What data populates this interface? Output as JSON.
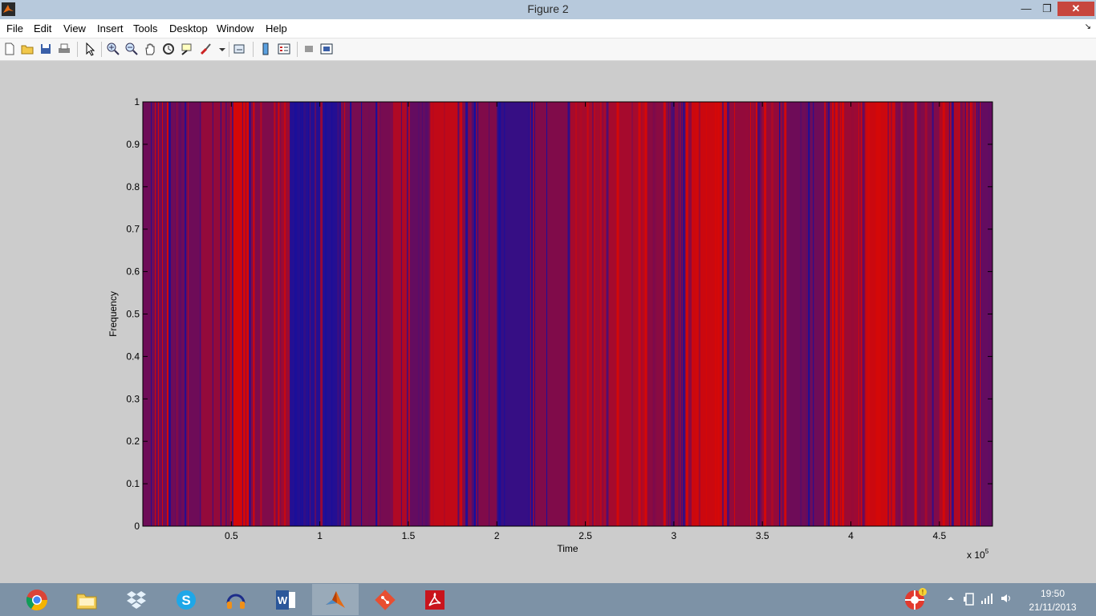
{
  "window": {
    "title": "Figure 2"
  },
  "menu": [
    "File",
    "Edit",
    "View",
    "Insert",
    "Tools",
    "Desktop",
    "Window",
    "Help"
  ],
  "toolbar": [
    "new-figure-icon",
    "open-file-icon",
    "save-icon",
    "print-icon",
    "edit-plot-arrow-icon",
    "zoom-in-icon",
    "zoom-out-icon",
    "pan-hand-icon",
    "rotate-3d-icon",
    "data-cursor-icon",
    "brush-icon",
    "link-plot-icon",
    "insert-colorbar-icon",
    "insert-legend-icon",
    "hide-plot-tools-icon",
    "show-plot-tools-icon"
  ],
  "chart_data": {
    "type": "heatmap",
    "title": "",
    "xlabel": "Time",
    "ylabel": "Frequency",
    "x_exponent_label": "x 10",
    "x_exponent": "5",
    "xlim": [
      0,
      4.8
    ],
    "ylim": [
      0,
      1
    ],
    "x_ticks": [
      "0.5",
      "1",
      "1.5",
      "2",
      "2.5",
      "3",
      "3.5",
      "4",
      "4.5"
    ],
    "y_ticks": [
      "0",
      "0.1",
      "0.2",
      "0.3",
      "0.4",
      "0.5",
      "0.6",
      "0.7",
      "0.8",
      "0.9",
      "1"
    ],
    "colors": {
      "low": "#1a0f9a",
      "high": "#d40808",
      "mid": "#8a0a3a"
    },
    "bands": [
      {
        "start": 0.0,
        "end": 0.33,
        "value": 0.45
      },
      {
        "start": 0.33,
        "end": 0.48,
        "value": 0.65
      },
      {
        "start": 0.48,
        "end": 0.6,
        "value": 1.0
      },
      {
        "start": 0.6,
        "end": 0.78,
        "value": 0.55
      },
      {
        "start": 0.78,
        "end": 0.83,
        "value": 0.7
      },
      {
        "start": 0.83,
        "end": 1.12,
        "value": 0.05
      },
      {
        "start": 1.12,
        "end": 1.4,
        "value": 0.5
      },
      {
        "start": 1.4,
        "end": 1.5,
        "value": 0.8
      },
      {
        "start": 1.5,
        "end": 1.62,
        "value": 0.4
      },
      {
        "start": 1.62,
        "end": 1.8,
        "value": 0.9
      },
      {
        "start": 1.8,
        "end": 2.0,
        "value": 0.55
      },
      {
        "start": 2.0,
        "end": 2.18,
        "value": 0.15
      },
      {
        "start": 2.18,
        "end": 2.4,
        "value": 0.55
      },
      {
        "start": 2.4,
        "end": 2.85,
        "value": 0.75
      },
      {
        "start": 2.85,
        "end": 3.1,
        "value": 0.6
      },
      {
        "start": 3.1,
        "end": 3.3,
        "value": 0.95
      },
      {
        "start": 3.3,
        "end": 3.6,
        "value": 0.65
      },
      {
        "start": 3.6,
        "end": 3.88,
        "value": 0.45
      },
      {
        "start": 3.88,
        "end": 4.05,
        "value": 0.7
      },
      {
        "start": 4.05,
        "end": 4.25,
        "value": 0.95
      },
      {
        "start": 4.25,
        "end": 4.5,
        "value": 0.55
      },
      {
        "start": 4.5,
        "end": 4.7,
        "value": 0.8
      },
      {
        "start": 4.7,
        "end": 4.8,
        "value": 0.4
      }
    ]
  },
  "taskbar": {
    "apps": [
      "chrome-icon",
      "file-explorer-icon",
      "dropbox-icon",
      "skype-icon",
      "audacity-icon",
      "word-icon",
      "matlab-icon",
      "git-icon",
      "acrobat-icon"
    ],
    "clock_time": "19:50",
    "clock_date": "21/11/2013"
  }
}
